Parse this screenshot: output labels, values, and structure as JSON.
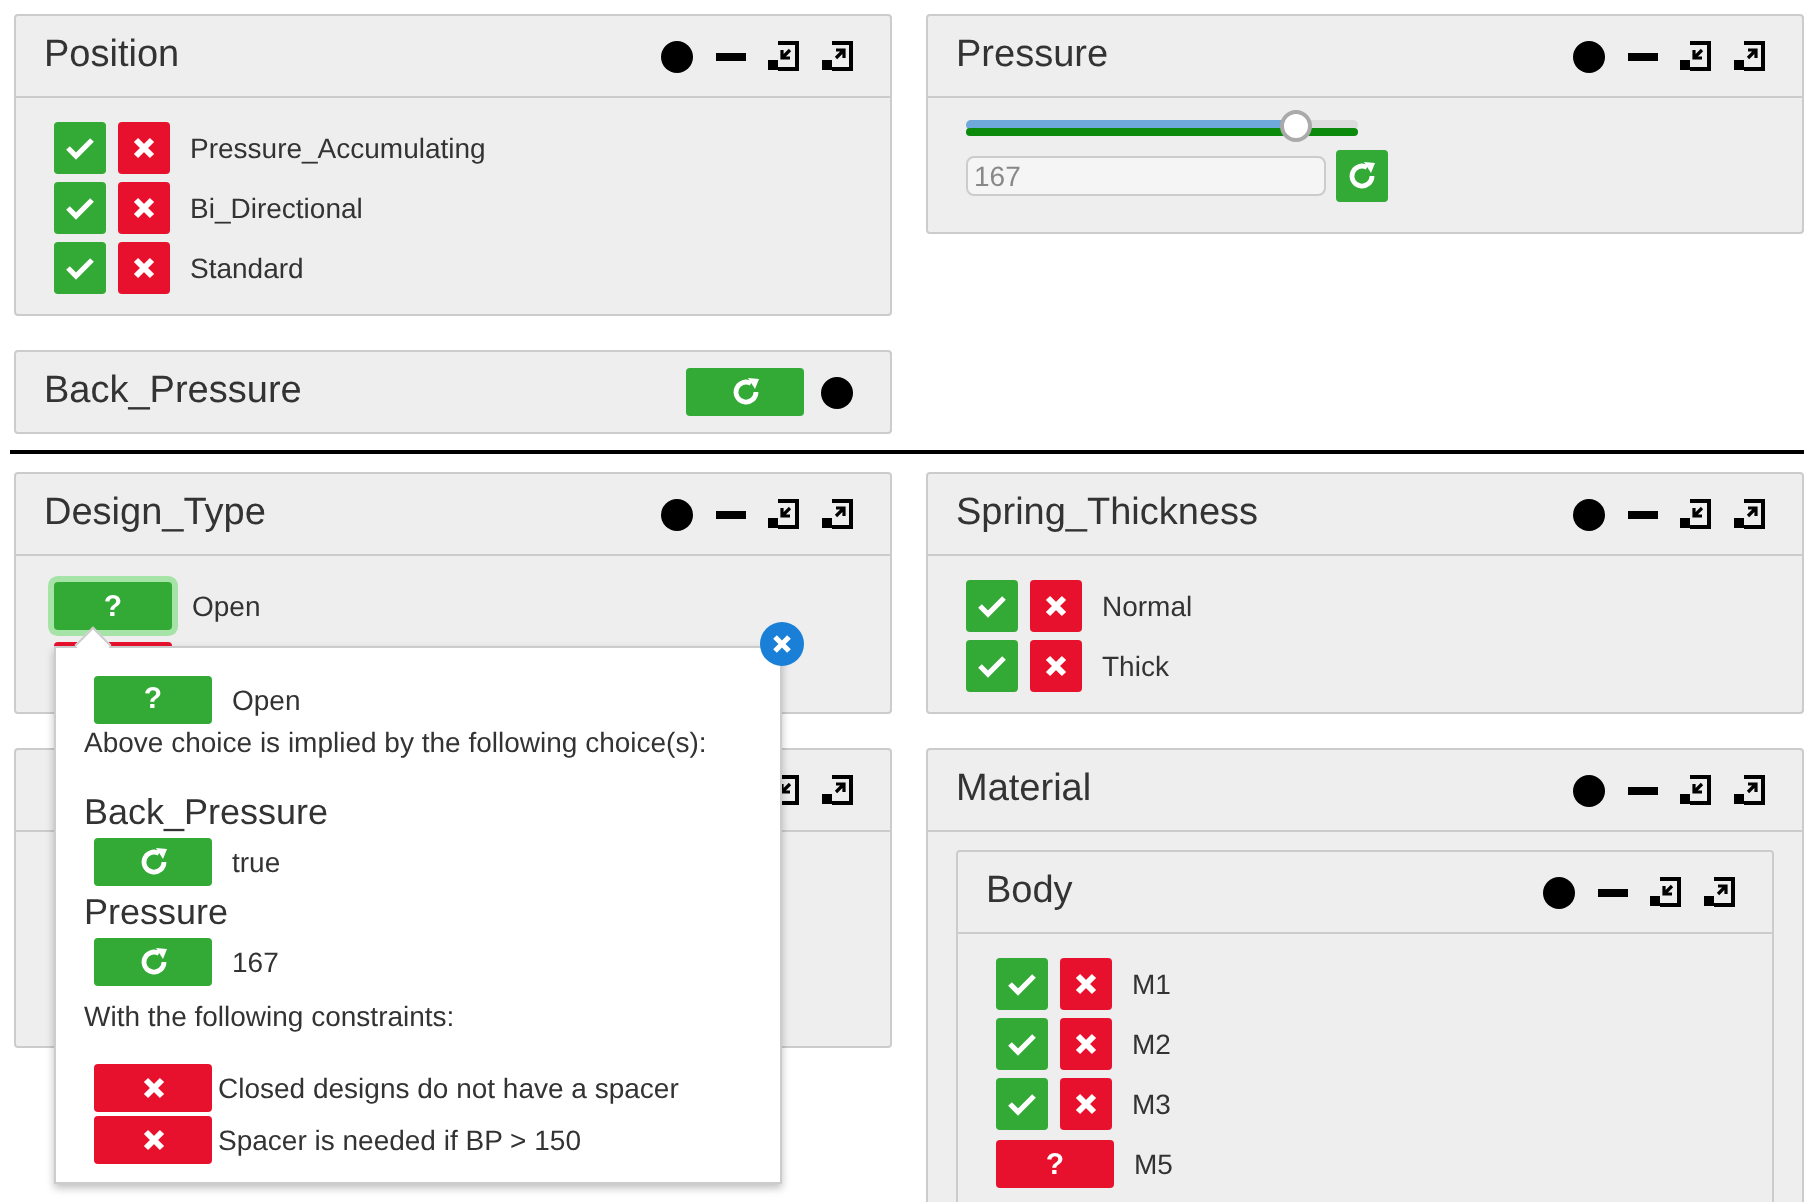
{
  "sections": [
    {
      "columns": [
        [
          {
            "title": "Position",
            "kind": "options",
            "options": [
              {
                "label": "Pressure_Accumulating",
                "kind": "choice"
              },
              {
                "label": "Bi_Directional",
                "kind": "choice"
              },
              {
                "label": "Standard",
                "kind": "choice"
              }
            ]
          },
          {
            "title": "Back_Pressure",
            "kind": "toggle"
          }
        ],
        [
          {
            "title": "Pressure",
            "kind": "slider",
            "level": 0.84,
            "value": "167"
          }
        ]
      ]
    },
    {
      "columns": [
        [
          {
            "title": "Design_Type",
            "kind": "options",
            "options": [
              {
                "label": "Open",
                "kind": "unknown",
                "mark": "?",
                "excluded": false,
                "focused": true
              },
              {
                "kind": "unknown",
                "excluded": true,
                "focused": false
              }
            ]
          },
          {
            "kind": "blank"
          }
        ],
        [
          {
            "title": "Spring_Thickness",
            "kind": "options",
            "options": [
              {
                "label": "Normal",
                "kind": "choice"
              },
              {
                "label": "Thick",
                "kind": "choice"
              }
            ]
          },
          {
            "title": "Material",
            "kind": "group",
            "children": [
              {
                "title": "Body",
                "kind": "options",
                "options": [
                  {
                    "label": "M1",
                    "kind": "choice"
                  },
                  {
                    "label": "M2",
                    "kind": "choice"
                  },
                  {
                    "label": "M3",
                    "kind": "choice"
                  },
                  {
                    "label": "M5",
                    "kind": "unknown",
                    "mark": "?",
                    "excluded": true,
                    "focused": false
                  }
                ]
              }
            ]
          }
        ]
      ]
    }
  ],
  "popover": {
    "choice": {
      "mark": "?",
      "label": "Open",
      "excluded": false
    },
    "intro": "Above choice is implied by the following choice(s):",
    "causes": [
      {
        "name": "Back_Pressure",
        "value": "true"
      },
      {
        "name": "Pressure",
        "value": "167"
      }
    ],
    "constraints_heading": "With the following constraints:",
    "constraints": [
      "Closed designs do not have a spacer",
      "Spacer is needed if BP > 150"
    ]
  }
}
